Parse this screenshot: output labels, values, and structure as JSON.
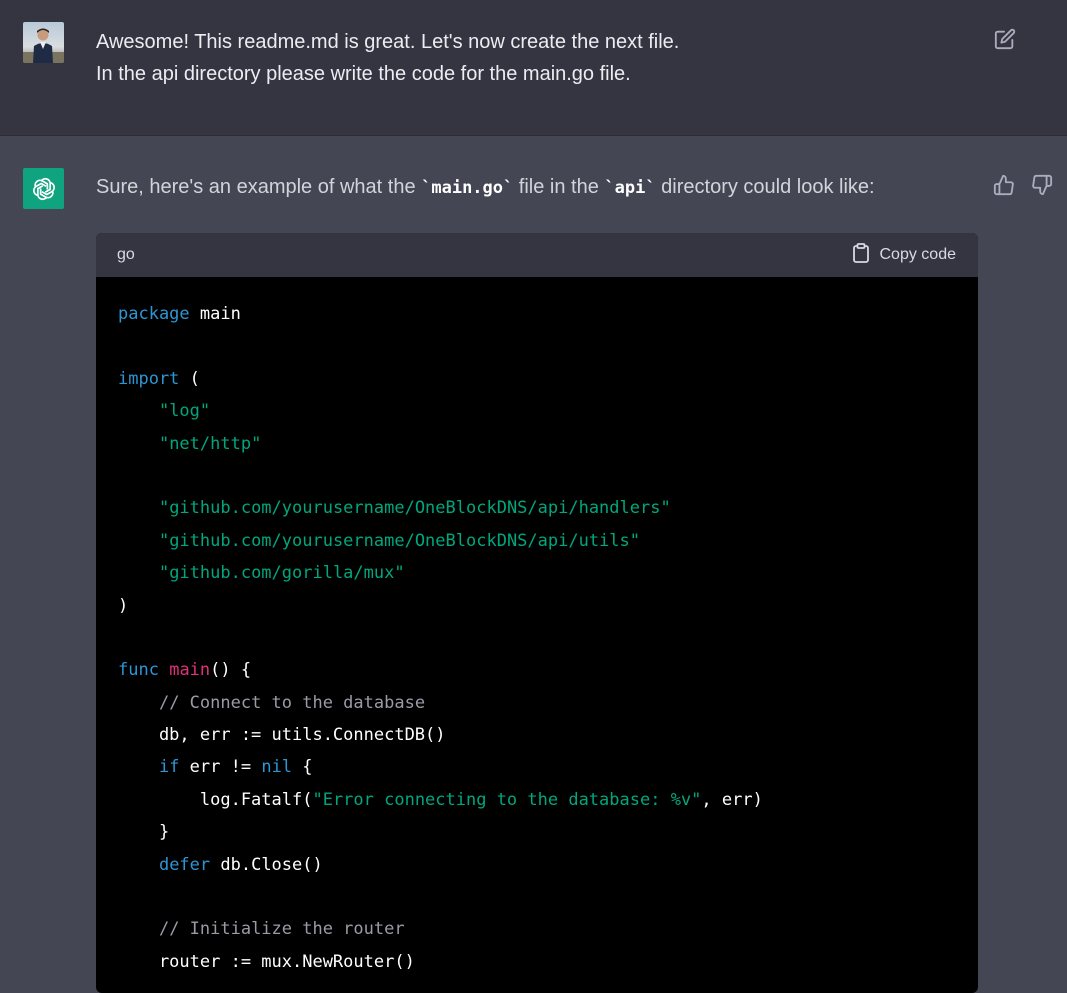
{
  "user_message": {
    "lines": [
      "Awesome! This readme.md is great. Let's now create the next file.",
      "In the api directory please write the code for the main.go file."
    ]
  },
  "assistant_message": {
    "intro_before": "Sure, here's an example of what the ",
    "intro_code1": "`main.go`",
    "intro_mid": " file in the ",
    "intro_code2": "`api`",
    "intro_after": " directory could look like:"
  },
  "code_block": {
    "language": "go",
    "copy_label": "Copy code",
    "lines": [
      [
        {
          "t": "package",
          "c": "kw"
        },
        {
          "t": " main",
          "c": "pl"
        }
      ],
      [],
      [
        {
          "t": "import",
          "c": "kw"
        },
        {
          "t": " (",
          "c": "pl"
        }
      ],
      [
        {
          "t": "    ",
          "c": "pl"
        },
        {
          "t": "\"log\"",
          "c": "str"
        }
      ],
      [
        {
          "t": "    ",
          "c": "pl"
        },
        {
          "t": "\"net/http\"",
          "c": "str"
        }
      ],
      [],
      [
        {
          "t": "    ",
          "c": "pl"
        },
        {
          "t": "\"github.com/yourusername/OneBlockDNS/api/handlers\"",
          "c": "str"
        }
      ],
      [
        {
          "t": "    ",
          "c": "pl"
        },
        {
          "t": "\"github.com/yourusername/OneBlockDNS/api/utils\"",
          "c": "str"
        }
      ],
      [
        {
          "t": "    ",
          "c": "pl"
        },
        {
          "t": "\"github.com/gorilla/mux\"",
          "c": "str"
        }
      ],
      [
        {
          "t": ")",
          "c": "pl"
        }
      ],
      [],
      [
        {
          "t": "func",
          "c": "kw"
        },
        {
          "t": " ",
          "c": "pl"
        },
        {
          "t": "main",
          "c": "fn"
        },
        {
          "t": "() {",
          "c": "pl"
        }
      ],
      [
        {
          "t": "    ",
          "c": "pl"
        },
        {
          "t": "// Connect to the database",
          "c": "cm"
        }
      ],
      [
        {
          "t": "    db, err := utils.ConnectDB()",
          "c": "pl"
        }
      ],
      [
        {
          "t": "    ",
          "c": "pl"
        },
        {
          "t": "if",
          "c": "kw"
        },
        {
          "t": " err != ",
          "c": "pl"
        },
        {
          "t": "nil",
          "c": "kw"
        },
        {
          "t": " {",
          "c": "pl"
        }
      ],
      [
        {
          "t": "        log.Fatalf(",
          "c": "pl"
        },
        {
          "t": "\"Error connecting to the database: %v\"",
          "c": "str"
        },
        {
          "t": ", err)",
          "c": "pl"
        }
      ],
      [
        {
          "t": "    }",
          "c": "pl"
        }
      ],
      [
        {
          "t": "    ",
          "c": "pl"
        },
        {
          "t": "defer",
          "c": "kw"
        },
        {
          "t": " db.Close()",
          "c": "pl"
        }
      ],
      [],
      [
        {
          "t": "    ",
          "c": "pl"
        },
        {
          "t": "// Initialize the router",
          "c": "cm"
        }
      ],
      [
        {
          "t": "    router := mux.NewRouter()",
          "c": "pl"
        }
      ]
    ]
  },
  "colors": {
    "user_bg": "#343541",
    "assistant_bg": "#444654",
    "brand_green": "#10a37f",
    "keyword": "#2e95d3",
    "string": "#00a67d",
    "function": "#df3079",
    "comment": "#9b9ba6"
  },
  "icons": {
    "edit": "edit-icon",
    "thumbs_up": "thumbs-up-icon",
    "thumbs_down": "thumbs-down-icon",
    "clipboard": "clipboard-icon",
    "openai_logo": "openai-logo-icon"
  }
}
